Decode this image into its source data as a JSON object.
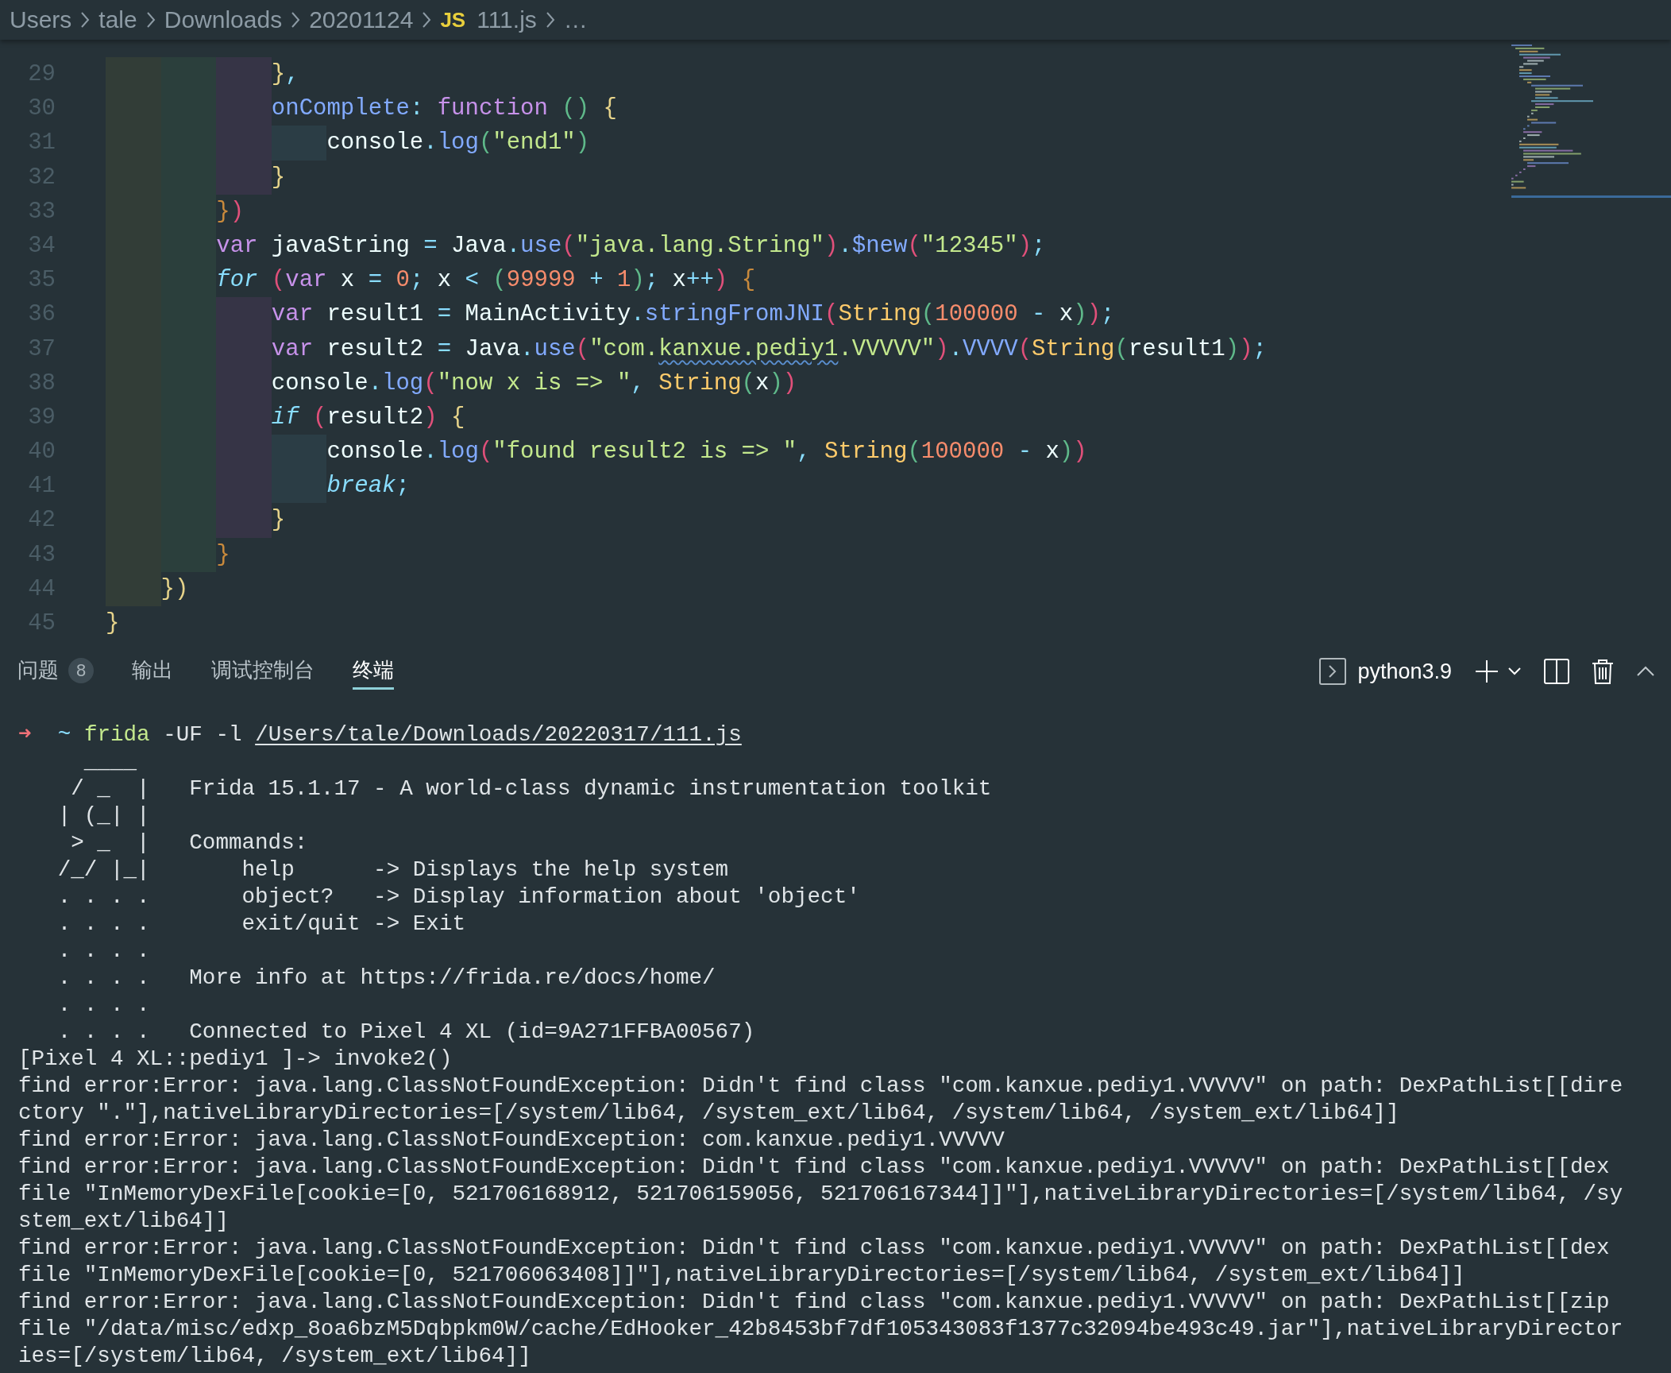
{
  "breadcrumbs": [
    {
      "label": "Users"
    },
    {
      "label": "tale"
    },
    {
      "label": "Downloads"
    },
    {
      "label": "20201124"
    },
    {
      "label": "111.js",
      "file_icon": "JS"
    },
    {
      "label": "…"
    }
  ],
  "editor": {
    "lines": [
      {
        "number": "29",
        "tokens": [
          {
            "text": "            }",
            "kind": "br1"
          },
          {
            "text": ",",
            "kind": "punc"
          }
        ]
      },
      {
        "number": "30",
        "tokens": [
          {
            "text": "            onComplete",
            "kind": "prop"
          },
          {
            "text": ":",
            "kind": "punc"
          },
          {
            "text": " function",
            "kind": "kw"
          },
          {
            "text": " (",
            "kind": "br3"
          },
          {
            "text": ")",
            "kind": "br3"
          },
          {
            "text": " {",
            "kind": "br1"
          }
        ]
      },
      {
        "number": "31",
        "tokens": [
          {
            "text": "                console",
            "kind": "plain"
          },
          {
            "text": ".",
            "kind": "punc"
          },
          {
            "text": "log",
            "kind": "fn"
          },
          {
            "text": "(",
            "kind": "br3"
          },
          {
            "text": "\"end1\"",
            "kind": "str"
          },
          {
            "text": ")",
            "kind": "br3"
          }
        ]
      },
      {
        "number": "32",
        "tokens": [
          {
            "text": "            }",
            "kind": "br1"
          }
        ]
      },
      {
        "number": "33",
        "tokens": [
          {
            "text": "        }",
            "kind": "br4"
          },
          {
            "text": ")",
            "kind": "br2"
          }
        ]
      },
      {
        "number": "34",
        "tokens": [
          {
            "text": "        var",
            "kind": "kw"
          },
          {
            "text": " javaString ",
            "kind": "plain"
          },
          {
            "text": "=",
            "kind": "punc"
          },
          {
            "text": " Java",
            "kind": "plain"
          },
          {
            "text": ".",
            "kind": "punc"
          },
          {
            "text": "use",
            "kind": "fn"
          },
          {
            "text": "(",
            "kind": "br2"
          },
          {
            "text": "\"java.lang.String\"",
            "kind": "str"
          },
          {
            "text": ")",
            "kind": "br2"
          },
          {
            "text": ".",
            "kind": "punc"
          },
          {
            "text": "$new",
            "kind": "fn"
          },
          {
            "text": "(",
            "kind": "br2"
          },
          {
            "text": "\"12345\"",
            "kind": "str"
          },
          {
            "text": ")",
            "kind": "br2"
          },
          {
            "text": ";",
            "kind": "punc"
          }
        ]
      },
      {
        "number": "35",
        "tokens": [
          {
            "text": "        for",
            "kind": "ctl"
          },
          {
            "text": " (",
            "kind": "br2"
          },
          {
            "text": "var",
            "kind": "kw"
          },
          {
            "text": " x ",
            "kind": "plain"
          },
          {
            "text": "=",
            "kind": "punc"
          },
          {
            "text": " 0",
            "kind": "num"
          },
          {
            "text": ";",
            "kind": "punc"
          },
          {
            "text": " x ",
            "kind": "plain"
          },
          {
            "text": "<",
            "kind": "punc"
          },
          {
            "text": " (",
            "kind": "br3"
          },
          {
            "text": "99999",
            "kind": "num"
          },
          {
            "text": " +",
            "kind": "punc"
          },
          {
            "text": " 1",
            "kind": "num"
          },
          {
            "text": ")",
            "kind": "br3"
          },
          {
            "text": ";",
            "kind": "punc"
          },
          {
            "text": " x",
            "kind": "plain"
          },
          {
            "text": "++",
            "kind": "punc"
          },
          {
            "text": ")",
            "kind": "br2"
          },
          {
            "text": " {",
            "kind": "br4"
          }
        ]
      },
      {
        "number": "36",
        "tokens": [
          {
            "text": "            var",
            "kind": "kw"
          },
          {
            "text": " result1 ",
            "kind": "plain"
          },
          {
            "text": "=",
            "kind": "punc"
          },
          {
            "text": " MainActivity",
            "kind": "plain"
          },
          {
            "text": ".",
            "kind": "punc"
          },
          {
            "text": "stringFromJNI",
            "kind": "fn"
          },
          {
            "text": "(",
            "kind": "br2"
          },
          {
            "text": "String",
            "kind": "cls"
          },
          {
            "text": "(",
            "kind": "br3"
          },
          {
            "text": "100000",
            "kind": "num"
          },
          {
            "text": " -",
            "kind": "punc"
          },
          {
            "text": " x",
            "kind": "plain"
          },
          {
            "text": ")",
            "kind": "br3"
          },
          {
            "text": ")",
            "kind": "br2"
          },
          {
            "text": ";",
            "kind": "punc"
          }
        ]
      },
      {
        "number": "37",
        "tokens": [
          {
            "text": "            var",
            "kind": "kw"
          },
          {
            "text": " result2 ",
            "kind": "plain"
          },
          {
            "text": "=",
            "kind": "punc"
          },
          {
            "text": " Java",
            "kind": "plain"
          },
          {
            "text": ".",
            "kind": "punc"
          },
          {
            "text": "use",
            "kind": "fn"
          },
          {
            "text": "(",
            "kind": "br2"
          },
          {
            "text": "\"com.",
            "kind": "str"
          },
          {
            "text": "kanxue.pediy1",
            "kind": "str",
            "squiggle": true
          },
          {
            "text": ".VVVVV\"",
            "kind": "str"
          },
          {
            "text": ")",
            "kind": "br2"
          },
          {
            "text": ".",
            "kind": "punc"
          },
          {
            "text": "VVVV",
            "kind": "fn"
          },
          {
            "text": "(",
            "kind": "br2"
          },
          {
            "text": "String",
            "kind": "cls"
          },
          {
            "text": "(",
            "kind": "br3"
          },
          {
            "text": "result1",
            "kind": "plain"
          },
          {
            "text": ")",
            "kind": "br3"
          },
          {
            "text": ")",
            "kind": "br2"
          },
          {
            "text": ";",
            "kind": "punc"
          }
        ]
      },
      {
        "number": "38",
        "tokens": [
          {
            "text": "            console",
            "kind": "plain"
          },
          {
            "text": ".",
            "kind": "punc"
          },
          {
            "text": "log",
            "kind": "fn"
          },
          {
            "text": "(",
            "kind": "br2"
          },
          {
            "text": "\"now x is => \"",
            "kind": "str"
          },
          {
            "text": ",",
            "kind": "punc"
          },
          {
            "text": " String",
            "kind": "cls"
          },
          {
            "text": "(",
            "kind": "br3"
          },
          {
            "text": "x",
            "kind": "plain"
          },
          {
            "text": ")",
            "kind": "br3"
          },
          {
            "text": ")",
            "kind": "br2"
          }
        ]
      },
      {
        "number": "39",
        "tokens": [
          {
            "text": "            if",
            "kind": "ctl"
          },
          {
            "text": " (",
            "kind": "br2"
          },
          {
            "text": "result2",
            "kind": "plain"
          },
          {
            "text": ")",
            "kind": "br2"
          },
          {
            "text": " {",
            "kind": "br1"
          }
        ]
      },
      {
        "number": "40",
        "tokens": [
          {
            "text": "                console",
            "kind": "plain"
          },
          {
            "text": ".",
            "kind": "punc"
          },
          {
            "text": "log",
            "kind": "fn"
          },
          {
            "text": "(",
            "kind": "br2"
          },
          {
            "text": "\"found result2 is => \"",
            "kind": "str"
          },
          {
            "text": ",",
            "kind": "punc"
          },
          {
            "text": " String",
            "kind": "cls"
          },
          {
            "text": "(",
            "kind": "br3"
          },
          {
            "text": "100000",
            "kind": "num"
          },
          {
            "text": " -",
            "kind": "punc"
          },
          {
            "text": " x",
            "kind": "plain"
          },
          {
            "text": ")",
            "kind": "br3"
          },
          {
            "text": ")",
            "kind": "br2"
          }
        ]
      },
      {
        "number": "41",
        "tokens": [
          {
            "text": "                break",
            "kind": "ctl"
          },
          {
            "text": ";",
            "kind": "punc"
          }
        ]
      },
      {
        "number": "42",
        "tokens": [
          {
            "text": "            }",
            "kind": "br1"
          }
        ]
      },
      {
        "number": "43",
        "tokens": [
          {
            "text": "        }",
            "kind": "br4"
          }
        ]
      },
      {
        "number": "44",
        "tokens": [
          {
            "text": "    }",
            "kind": "br1"
          },
          {
            "text": ")",
            "kind": "br1"
          }
        ]
      },
      {
        "number": "45",
        "tokens": [
          {
            "text": "}",
            "kind": "br1"
          }
        ]
      }
    ]
  },
  "panel": {
    "tabs": [
      {
        "label": "问题",
        "badge": "8",
        "selected": false
      },
      {
        "label": "输出",
        "selected": false
      },
      {
        "label": "调试控制台",
        "selected": false
      },
      {
        "label": "终端",
        "selected": true
      }
    ],
    "terminal_selector": {
      "label": "python3.9"
    }
  },
  "terminal": {
    "prompt": {
      "arrow": "➜",
      "cwd": "~",
      "command": "frida",
      "args": "-UF -l",
      "path": "/Users/tale/Downloads/20220317/111.js"
    },
    "lines": [
      "     ____",
      "    / _  |   Frida 15.1.17 - A world-class dynamic instrumentation toolkit",
      "   | (_| |",
      "    > _  |   Commands:",
      "   /_/ |_|       help      -> Displays the help system",
      "   . . . .       object?   -> Display information about 'object'",
      "   . . . .       exit/quit -> Exit",
      "   . . . .",
      "   . . . .   More info at https://frida.re/docs/home/",
      "   . . . .",
      "   . . . .   Connected to Pixel 4 XL (id=9A271FFBA00567)",
      "[Pixel 4 XL::pediy1 ]-> invoke2()",
      "find error:Error: java.lang.ClassNotFoundException: Didn't find class \"com.kanxue.pediy1.VVVVV\" on path: DexPathList[[dire",
      "ctory \".\"],nativeLibraryDirectories=[/system/lib64, /system_ext/lib64, /system/lib64, /system_ext/lib64]]",
      "find error:Error: java.lang.ClassNotFoundException: com.kanxue.pediy1.VVVVV",
      "find error:Error: java.lang.ClassNotFoundException: Didn't find class \"com.kanxue.pediy1.VVVVV\" on path: DexPathList[[dex",
      "file \"InMemoryDexFile[cookie=[0, 521706168912, 521706159056, 521706167344]]\"],nativeLibraryDirectories=[/system/lib64, /sy",
      "stem_ext/lib64]]",
      "find error:Error: java.lang.ClassNotFoundException: Didn't find class \"com.kanxue.pediy1.VVVVV\" on path: DexPathList[[dex",
      "file \"InMemoryDexFile[cookie=[0, 521706063408]]\"],nativeLibraryDirectories=[/system/lib64, /system_ext/lib64]]",
      "find error:Error: java.lang.ClassNotFoundException: Didn't find class \"com.kanxue.pediy1.VVVVV\" on path: DexPathList[[zip",
      "file \"/data/misc/edxp_8oa6bzM5Dqbpkm0W/cache/EdHooker_42b8453bf7df105343083f1377c32094be493c49.jar\"],nativeLibraryDirector",
      "ies=[/system/lib64, /system_ext/lib64]]"
    ]
  }
}
